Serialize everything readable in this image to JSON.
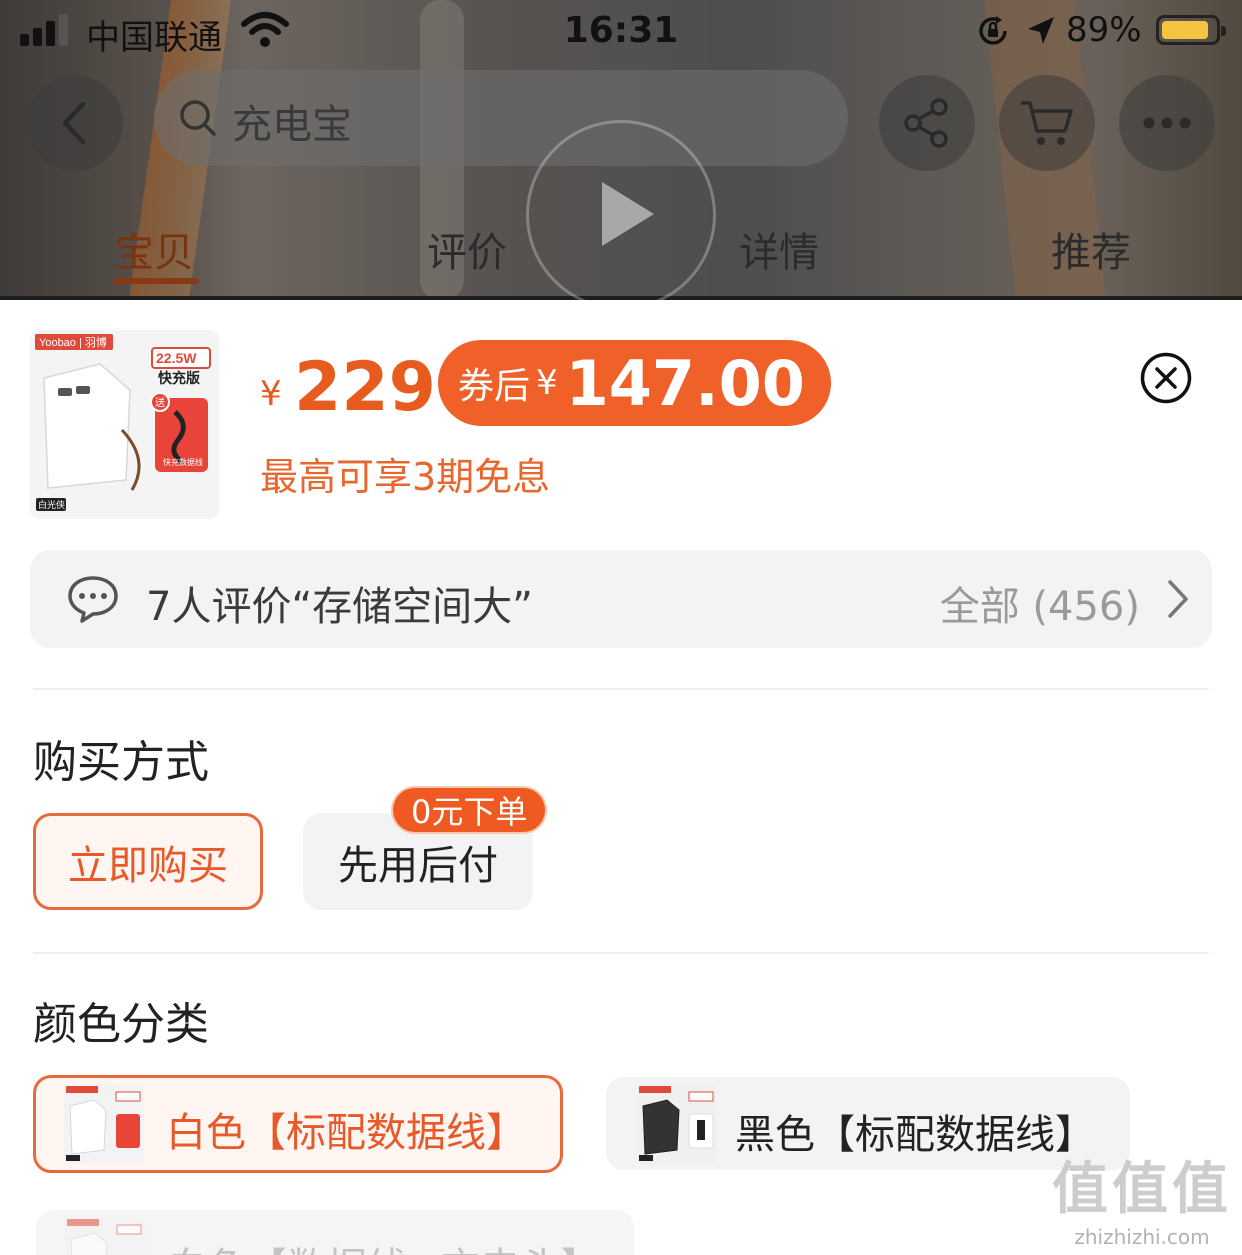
{
  "status_bar": {
    "carrier": "中国联通",
    "time": "16:31",
    "battery_percent": "89%",
    "battery_level": 0.89
  },
  "search": {
    "placeholder": "充电宝"
  },
  "tabs": [
    {
      "label": "宝贝",
      "active": true
    },
    {
      "label": "评价",
      "active": false
    },
    {
      "label": "详情",
      "active": false
    },
    {
      "label": "推荐",
      "active": false
    }
  ],
  "product": {
    "thumb": {
      "brand": "Yoobao | 羽博",
      "power": "22.5W",
      "edition": "快充版",
      "gift": "送",
      "cable": "快充数据线",
      "color_tag": "白光侠"
    },
    "price_symbol": "¥",
    "price": "229",
    "coupon_label": "券后",
    "coupon_symbol": "¥",
    "coupon_price": "147.00",
    "installment": "最高可享3期免息"
  },
  "reviews": {
    "summary": "7人评价“存储空间大”",
    "all_label": "全部 (456)"
  },
  "purchase": {
    "title": "购买方式",
    "options": [
      {
        "label": "立即购买",
        "selected": true
      },
      {
        "label": "先用后付",
        "selected": false,
        "badge": "0元下单"
      }
    ]
  },
  "color": {
    "title": "颜色分类",
    "options": [
      {
        "label": "白色【标配数据线】",
        "selected": true
      },
      {
        "label": "黑色【标配数据线】",
        "selected": false
      },
      {
        "label": "白色【数据线+充电头】",
        "selected": false
      }
    ]
  },
  "watermark": {
    "logo": "值值值",
    "url": "zhizhizhi.com"
  },
  "colors": {
    "accent": "#f0612a",
    "accent_text": "#e8592a"
  }
}
